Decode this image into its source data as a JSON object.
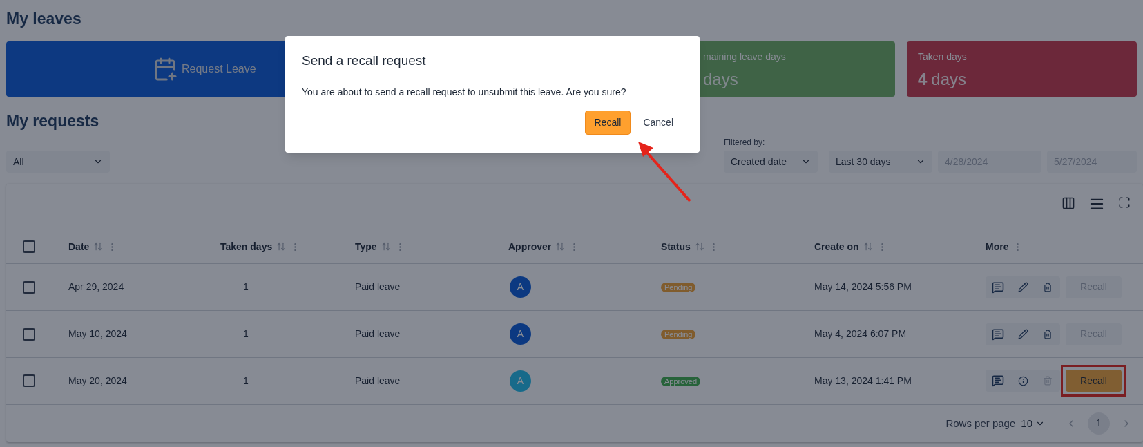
{
  "page_title": "My leaves",
  "request_card": {
    "label": "Request Leave"
  },
  "stat_cards": [
    {
      "kind": "remaining",
      "label": "maining leave days",
      "unit": "days"
    },
    {
      "kind": "taken",
      "label": "Taken days",
      "value": "4",
      "unit": "days"
    }
  ],
  "section_title": "My requests",
  "status_filter": {
    "value": "All"
  },
  "filter": {
    "label": "Filtered by:",
    "field": "Created date",
    "range": "Last 30 days",
    "from": "4/28/2024",
    "to": "5/27/2024"
  },
  "table": {
    "select_all_checked": false,
    "columns": [
      {
        "label": "Date",
        "sortable": true
      },
      {
        "label": "Taken days",
        "sortable": true
      },
      {
        "label": "Type",
        "sortable": true
      },
      {
        "label": "Approver",
        "sortable": true
      },
      {
        "label": "Status",
        "sortable": true
      },
      {
        "label": "Create on",
        "sortable": true
      },
      {
        "label": "More",
        "sortable": false
      }
    ],
    "rows": [
      {
        "checked": false,
        "date": "Apr 29, 2024",
        "taken": "1",
        "type": "Paid leave",
        "approver": {
          "initial": "A",
          "color": "#0c3981"
        },
        "status": {
          "kind": "pending",
          "label": "Pending"
        },
        "created": "May 14, 2024 5:56 PM",
        "actions": [
          {
            "kind": "comment",
            "disabled": false
          },
          {
            "kind": "edit",
            "disabled": false
          },
          {
            "kind": "delete",
            "disabled": false
          }
        ],
        "recall": {
          "label": "Recall",
          "disabled": true,
          "highlighted": false
        }
      },
      {
        "checked": false,
        "date": "May 10, 2024",
        "taken": "1",
        "type": "Paid leave",
        "approver": {
          "initial": "A",
          "color": "#0c3981"
        },
        "status": {
          "kind": "pending",
          "label": "Pending"
        },
        "created": "May 4, 2024 6:07 PM",
        "actions": [
          {
            "kind": "comment",
            "disabled": false
          },
          {
            "kind": "edit",
            "disabled": false
          },
          {
            "kind": "delete",
            "disabled": false
          }
        ],
        "recall": {
          "label": "Recall",
          "disabled": true,
          "highlighted": false
        }
      },
      {
        "checked": false,
        "date": "May 20, 2024",
        "taken": "1",
        "type": "Paid leave",
        "approver": {
          "initial": "A",
          "color": "#176a8a"
        },
        "status": {
          "kind": "approved",
          "label": "Approved"
        },
        "created": "May 13, 2024 1:41 PM",
        "actions": [
          {
            "kind": "comment",
            "disabled": false
          },
          {
            "kind": "info",
            "disabled": false
          },
          {
            "kind": "delete",
            "disabled": true
          }
        ],
        "recall": {
          "label": "Recall",
          "disabled": false,
          "highlighted": true
        }
      }
    ]
  },
  "pagination": {
    "rows_per_page_label": "Rows per page",
    "rows_per_page": "10",
    "pages": [
      {
        "label": "1",
        "selected": true
      }
    ]
  },
  "dialog": {
    "title": "Send a recall request",
    "message": "You are about to send a recall request to unsubmit this leave. Are you sure?",
    "confirm": "Recall",
    "cancel": "Cancel"
  }
}
